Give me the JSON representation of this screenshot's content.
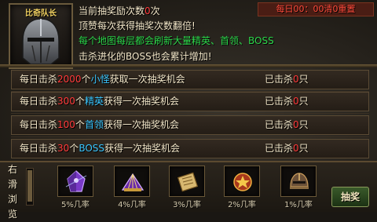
{
  "header": {
    "portrait_name": "比奇队长",
    "lottery_count_prefix": "当前抽奖励次数",
    "lottery_count_value": "0",
    "lottery_count_suffix": "次",
    "daily_reset": "每日00：00清0重置",
    "tip_line": "顶赞每次获得抽奖次数翻倍!",
    "green_tip_1": "每个地图每层都会刷新大量精英、首领、BOSS",
    "green_tip_2": "击杀进化的BOSS也会累计增加!"
  },
  "tasks": [
    {
      "pre": "每日击杀",
      "count": "2000",
      "unit": "个",
      "target": "小怪",
      "post": "获取一次抽奖机会",
      "killed_prefix": "已击杀",
      "killed_value": "0",
      "killed_suffix": "只"
    },
    {
      "pre": "每日击杀",
      "count": "300",
      "unit": "个",
      "target": "精英",
      "post": "获得一次抽奖机会",
      "killed_prefix": "已击杀",
      "killed_value": "0",
      "killed_suffix": "只"
    },
    {
      "pre": "每日击杀",
      "count": "100",
      "unit": "个",
      "target": "首领",
      "post": "获得一次抽奖机会",
      "killed_prefix": "已击杀",
      "killed_value": "0",
      "killed_suffix": "只"
    },
    {
      "pre": "每日击杀",
      "count": "30",
      "unit": "个",
      "target": "BOSS",
      "post": "获得一次抽奖机会",
      "killed_prefix": "已击杀",
      "killed_value": "0",
      "killed_suffix": "只"
    }
  ],
  "scroll_hint": [
    "右",
    "滑",
    "浏",
    "览"
  ],
  "prizes": [
    {
      "rate": "5%几率",
      "icon": "purple-crystal-icon"
    },
    {
      "rate": "4%几率",
      "icon": "purple-fan-icon"
    },
    {
      "rate": "3%几率",
      "icon": "scroll-icon"
    },
    {
      "rate": "2%几率",
      "icon": "medal-icon"
    },
    {
      "rate": "1%几率",
      "icon": "helmet-icon"
    }
  ],
  "draw_button": "抽奖",
  "colors": {
    "highlight_red": "#ff3a3a",
    "highlight_cyan": "#39c6ff",
    "tip_green": "#2cd64a",
    "text_cream": "#f2e6c8"
  }
}
